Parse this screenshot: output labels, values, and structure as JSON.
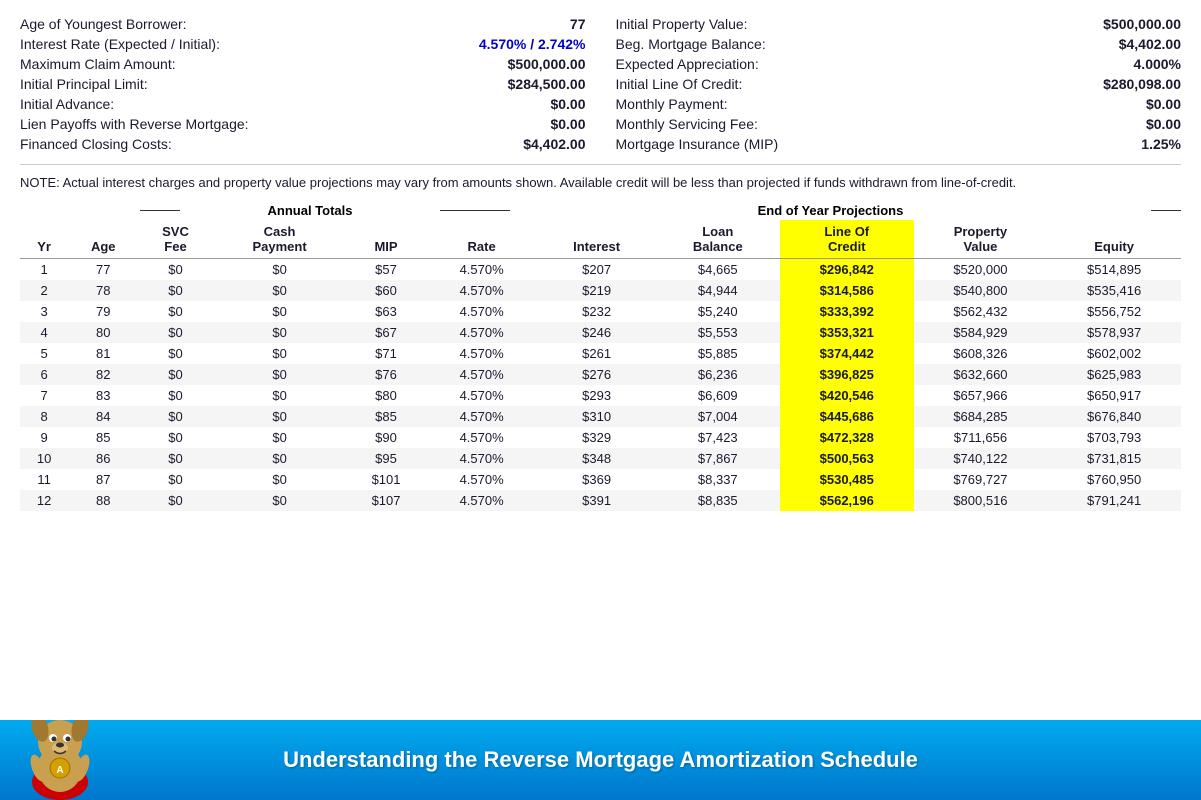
{
  "summary": {
    "left_col": [
      {
        "label": "Age of Youngest Borrower:",
        "value": "77",
        "highlight": false
      },
      {
        "label": "Interest Rate (Expected / Initial):",
        "value": "4.570%  /  2.742%",
        "highlight": true
      },
      {
        "label": "Maximum Claim Amount:",
        "value": "$500,000.00",
        "highlight": false
      },
      {
        "label": "Initial Principal Limit:",
        "value": "$284,500.00",
        "highlight": false
      },
      {
        "label": "Initial Advance:",
        "value": "$0.00",
        "highlight": false
      },
      {
        "label": "Lien Payoffs with Reverse Mortgage:",
        "value": "$0.00",
        "highlight": false
      },
      {
        "label": "Financed Closing Costs:",
        "value": "$4,402.00",
        "highlight": false
      }
    ],
    "right_col": [
      {
        "label": "Initial Property Value:",
        "value": "$500,000.00",
        "highlight": false
      },
      {
        "label": "Beg. Mortgage Balance:",
        "value": "$4,402.00",
        "highlight": false
      },
      {
        "label": "Expected Appreciation:",
        "value": "4.000%",
        "highlight": false
      },
      {
        "label": "Initial Line Of Credit:",
        "value": "$280,098.00",
        "highlight": false
      },
      {
        "label": "Monthly Payment:",
        "value": "$0.00",
        "highlight": false
      },
      {
        "label": "Monthly Servicing Fee:",
        "value": "$0.00",
        "highlight": false
      },
      {
        "label": "Mortgage Insurance (MIP)",
        "value": "1.25%",
        "highlight": false
      }
    ]
  },
  "note": "NOTE:  Actual interest charges and property value projections may vary from amounts shown.  Available credit will be less than projected if funds withdrawn from line-of-credit.",
  "table": {
    "annual_header": "Annual Totals",
    "eoy_header": "End of Year Projections",
    "columns": [
      {
        "key": "yr",
        "label": "Yr",
        "label2": ""
      },
      {
        "key": "age",
        "label": "Age",
        "label2": ""
      },
      {
        "key": "svc",
        "label": "SVC",
        "label2": "Fee"
      },
      {
        "key": "cash",
        "label": "Cash",
        "label2": "Payment"
      },
      {
        "key": "mip",
        "label": "MIP",
        "label2": ""
      },
      {
        "key": "rate",
        "label": "Rate",
        "label2": ""
      },
      {
        "key": "interest",
        "label": "Interest",
        "label2": ""
      },
      {
        "key": "loan",
        "label": "Loan",
        "label2": "Balance"
      },
      {
        "key": "loc",
        "label": "Line Of",
        "label2": "Credit"
      },
      {
        "key": "prop",
        "label": "Property",
        "label2": "Value"
      },
      {
        "key": "equity",
        "label": "Equity",
        "label2": ""
      }
    ],
    "rows": [
      {
        "yr": "1",
        "age": "77",
        "svc": "$0",
        "cash": "$0",
        "mip": "$57",
        "rate": "4.570%",
        "interest": "$207",
        "loan": "$4,665",
        "loc": "$296,842",
        "prop": "$520,000",
        "equity": "$514,895"
      },
      {
        "yr": "2",
        "age": "78",
        "svc": "$0",
        "cash": "$0",
        "mip": "$60",
        "rate": "4.570%",
        "interest": "$219",
        "loan": "$4,944",
        "loc": "$314,586",
        "prop": "$540,800",
        "equity": "$535,416"
      },
      {
        "yr": "3",
        "age": "79",
        "svc": "$0",
        "cash": "$0",
        "mip": "$63",
        "rate": "4.570%",
        "interest": "$232",
        "loan": "$5,240",
        "loc": "$333,392",
        "prop": "$562,432",
        "equity": "$556,752"
      },
      {
        "yr": "4",
        "age": "80",
        "svc": "$0",
        "cash": "$0",
        "mip": "$67",
        "rate": "4.570%",
        "interest": "$246",
        "loan": "$5,553",
        "loc": "$353,321",
        "prop": "$584,929",
        "equity": "$578,937"
      },
      {
        "yr": "5",
        "age": "81",
        "svc": "$0",
        "cash": "$0",
        "mip": "$71",
        "rate": "4.570%",
        "interest": "$261",
        "loan": "$5,885",
        "loc": "$374,442",
        "prop": "$608,326",
        "equity": "$602,002"
      },
      {
        "yr": "6",
        "age": "82",
        "svc": "$0",
        "cash": "$0",
        "mip": "$76",
        "rate": "4.570%",
        "interest": "$276",
        "loan": "$6,236",
        "loc": "$396,825",
        "prop": "$632,660",
        "equity": "$625,983"
      },
      {
        "yr": "7",
        "age": "83",
        "svc": "$0",
        "cash": "$0",
        "mip": "$80",
        "rate": "4.570%",
        "interest": "$293",
        "loan": "$6,609",
        "loc": "$420,546",
        "prop": "$657,966",
        "equity": "$650,917"
      },
      {
        "yr": "8",
        "age": "84",
        "svc": "$0",
        "cash": "$0",
        "mip": "$85",
        "rate": "4.570%",
        "interest": "$310",
        "loan": "$7,004",
        "loc": "$445,686",
        "prop": "$684,285",
        "equity": "$676,840"
      },
      {
        "yr": "9",
        "age": "85",
        "svc": "$0",
        "cash": "$0",
        "mip": "$90",
        "rate": "4.570%",
        "interest": "$329",
        "loan": "$7,423",
        "loc": "$472,328",
        "prop": "$711,656",
        "equity": "$703,793"
      },
      {
        "yr": "10",
        "age": "86",
        "svc": "$0",
        "cash": "$0",
        "mip": "$95",
        "rate": "4.570%",
        "interest": "$348",
        "loan": "$7,867",
        "loc": "$500,563",
        "prop": "$740,122",
        "equity": "$731,815"
      },
      {
        "yr": "11",
        "age": "87",
        "svc": "$0",
        "cash": "$0",
        "mip": "$101",
        "rate": "4.570%",
        "interest": "$369",
        "loan": "$8,337",
        "loc": "$530,485",
        "prop": "$769,727",
        "equity": "$760,950"
      },
      {
        "yr": "12",
        "age": "88",
        "svc": "$0",
        "cash": "$0",
        "mip": "$107",
        "rate": "4.570%",
        "interest": "$391",
        "loan": "$8,835",
        "loc": "$562,196",
        "prop": "$800,516",
        "equity": "$791,241"
      }
    ]
  },
  "footer": {
    "text": "Understanding the Reverse Mortgage Amortization Schedule"
  }
}
